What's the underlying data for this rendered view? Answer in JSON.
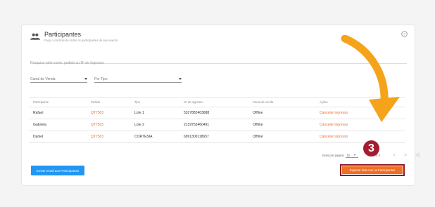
{
  "header": {
    "title": "Participantes",
    "subtitle": "Faça o controle de todos os participantes de seu evento."
  },
  "search": {
    "placeholder": "Pesquise pelo nome, pedido ou Nº de Ingresso"
  },
  "filters": {
    "canal_label": "Canal de Venda",
    "tipo_label": "Por Tipo"
  },
  "table": {
    "headers": [
      "Participante",
      "Pedido",
      "Tipo",
      "Nº do Ingresso",
      "Canal de venda",
      "Ações"
    ],
    "rows": [
      {
        "participante": "Rafael",
        "pedido": "QT7503",
        "tipo": "Lote 1",
        "ingresso": "5327882403688",
        "canal": "Offline",
        "acao": "Cancelar ingresso"
      },
      {
        "participante": "Gabriela",
        "pedido": "QT7503",
        "tipo": "Lote 2",
        "ingresso": "2139753460491",
        "canal": "Offline",
        "acao": "Cancelar ingresso"
      },
      {
        "participante": "Daniel",
        "pedido": "QT7503",
        "tipo": "CORTESIA",
        "ingresso": "6991300118657",
        "canal": "Offline",
        "acao": "Cancelar ingresso"
      }
    ]
  },
  "pagination": {
    "items_per_page_label": "Itens por página:",
    "items_per_page_value": "10",
    "range": "1 - 3 of 3",
    "prev": "<",
    "next": ">",
    "last": ">|"
  },
  "actions": {
    "email_button": "Enviar email aos Participantes",
    "export_button": "Exportar lista com os Participantes"
  },
  "annotation": {
    "step_number": "3"
  },
  "colors": {
    "accent_orange": "#f26f21",
    "primary_blue": "#2196f3",
    "badge_red": "#a51c30",
    "arrow_yellow": "#f5a31a"
  }
}
